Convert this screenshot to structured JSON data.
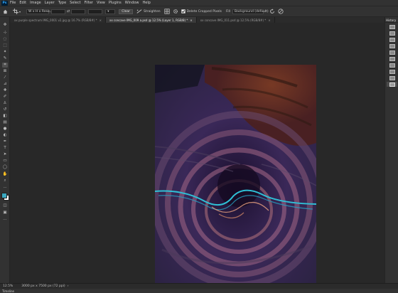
{
  "app": {
    "logo": "Ps"
  },
  "menu": [
    "File",
    "Edit",
    "Image",
    "Layer",
    "Type",
    "Select",
    "Filter",
    "View",
    "Plugins",
    "Window",
    "Help"
  ],
  "options": {
    "ratio_label": "W x H x Reso...",
    "straighten_label": "Straighten",
    "clear_label": "Clear",
    "delete_cropped_label": "Delete Cropped Pixels",
    "fill_label": "Fill",
    "fill_value": "Background (default)",
    "delete_cropped_checked": true
  },
  "tabs": [
    {
      "label": "xx purple spectrum IMG_0001 v2.jpg @ 16.7% (RGB/8#) *",
      "active": false
    },
    {
      "label": "xx concave IMG_009 a.psd @ 12.5% (Layer 1, RGB/8) *",
      "active": true
    },
    {
      "label": "xx concave IMG_011.psd @ 12.5% (RGB/8#) *",
      "active": false
    }
  ],
  "tools": [
    "move",
    "artboard",
    "lasso",
    "marquee",
    "magic-wand",
    "crop",
    "frame",
    "eyedropper",
    "ruler",
    "healing",
    "brush",
    "clone",
    "history-brush",
    "eraser",
    "gradient",
    "blur",
    "dodge",
    "pen",
    "type",
    "path-select",
    "rectangle",
    "hand",
    "zoom",
    "more"
  ],
  "panel": {
    "title": "History",
    "item_count": 10
  },
  "status": {
    "zoom": "12.5%",
    "doc_info": "3000 px x 7500 px (72 ppi)"
  },
  "timeline_label": "Timeline",
  "colors": {
    "foreground": "#3aa8c0",
    "background": "#ffffff",
    "accent": "#31a8ff"
  }
}
